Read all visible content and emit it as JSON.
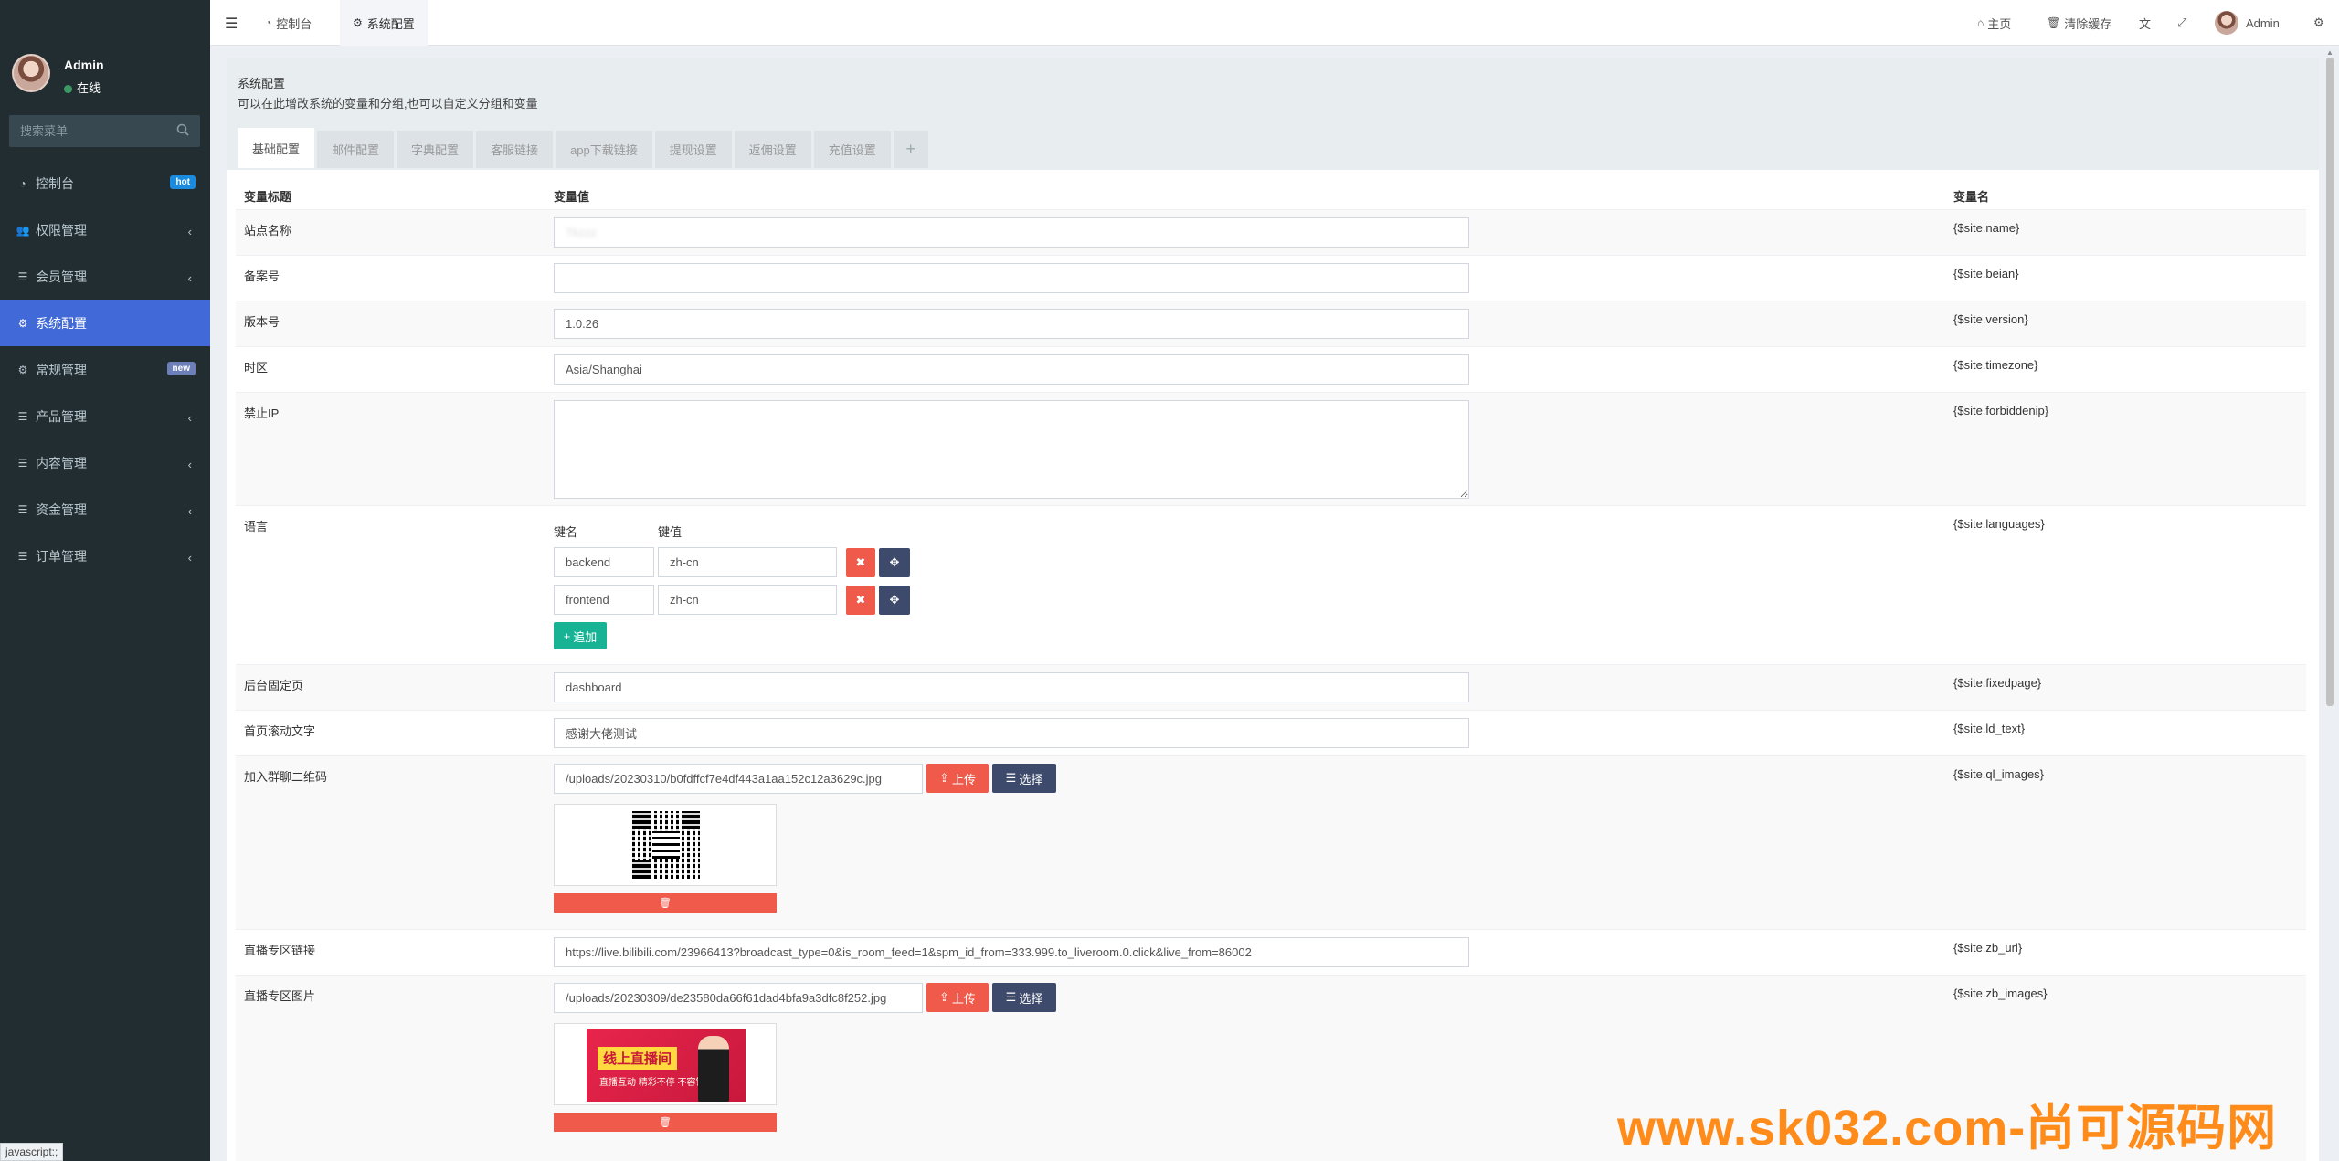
{
  "sidebar": {
    "user_name": "Admin",
    "user_status": "在线",
    "search_placeholder": "搜索菜单",
    "items": [
      {
        "label": "控制台",
        "icon": "dashboard-icon",
        "badge": "hot"
      },
      {
        "label": "权限管理",
        "icon": "group-icon"
      },
      {
        "label": "会员管理",
        "icon": "list-icon"
      },
      {
        "label": "系统配置",
        "icon": "gear-icon",
        "active": true
      },
      {
        "label": "常规管理",
        "icon": "cogs-icon",
        "badge": "new"
      },
      {
        "label": "产品管理",
        "icon": "list-icon"
      },
      {
        "label": "内容管理",
        "icon": "list-icon"
      },
      {
        "label": "资金管理",
        "icon": "list-icon"
      },
      {
        "label": "订单管理",
        "icon": "list-icon"
      }
    ]
  },
  "topbar": {
    "tabs": [
      {
        "label": "控制台",
        "icon": "dashboard-icon"
      },
      {
        "label": "系统配置",
        "icon": "gear-icon",
        "active": true
      }
    ],
    "home": "主页",
    "clear_cache": "清除缓存",
    "admin": "Admin"
  },
  "panel": {
    "title": "系统配置",
    "description": "可以在此增改系统的变量和分组,也可以自定义分组和变量",
    "tabs": [
      "基础配置",
      "邮件配置",
      "字典配置",
      "客服链接",
      "app下载链接",
      "提现设置",
      "返佣设置",
      "充值设置",
      "+"
    ]
  },
  "table": {
    "headers": {
      "title": "变量标题",
      "value": "变量值",
      "name": "变量名"
    },
    "rows": {
      "site_name": {
        "label": "站点名称",
        "value": "Tkzzz",
        "var": "{$site.name}"
      },
      "beian": {
        "label": "备案号",
        "value": "",
        "var": "{$site.beian}"
      },
      "version": {
        "label": "版本号",
        "value": "1.0.26",
        "var": "{$site.version}"
      },
      "timezone": {
        "label": "时区",
        "value": "Asia/Shanghai",
        "var": "{$site.timezone}"
      },
      "forbiddenip": {
        "label": "禁止IP",
        "value": "",
        "var": "{$site.forbiddenip}"
      },
      "languages": {
        "label": "语言",
        "var": "{$site.languages}",
        "key_header": "键名",
        "value_header": "键值",
        "pairs": [
          {
            "key": "backend",
            "value": "zh-cn"
          },
          {
            "key": "frontend",
            "value": "zh-cn"
          }
        ],
        "add_label": "追加"
      },
      "fixedpage": {
        "label": "后台固定页",
        "value": "dashboard",
        "var": "{$site.fixedpage}"
      },
      "ld_text": {
        "label": "首页滚动文字",
        "value": "感谢大佬测试",
        "var": "{$site.ld_text}"
      },
      "ql_images": {
        "label": "加入群聊二维码",
        "value": "/uploads/20230310/b0fdffcf7e4df443a1aa152c12a3629c.jpg",
        "var": "{$site.ql_images}",
        "upload": "上传",
        "select": "选择"
      },
      "zb_url": {
        "label": "直播专区链接",
        "value": "https://live.bilibili.com/23966413?broadcast_type=0&is_room_feed=1&spm_id_from=333.999.to_liveroom.0.click&live_from=86002",
        "var": "{$site.zb_url}"
      },
      "zb_images": {
        "label": "直播专区图片",
        "value": "/uploads/20230309/de23580da66f61dad4bfa9a3dfc8f252.jpg",
        "var": "{$site.zb_images}",
        "upload": "上传",
        "select": "选择",
        "banner_title": "线上直播间",
        "banner_sub": "直播互动 精彩不停 不容错过"
      }
    }
  },
  "status_bar": "javascript:;",
  "watermark": "www.sk032.com-尚可源码网",
  "colors": {
    "sidebar_bg": "#222d32",
    "active_menu": "#4169d7",
    "danger": "#f05a4a",
    "dark_btn": "#3d4a6b",
    "success": "#18b394",
    "watermark": "#ff8c1a"
  }
}
